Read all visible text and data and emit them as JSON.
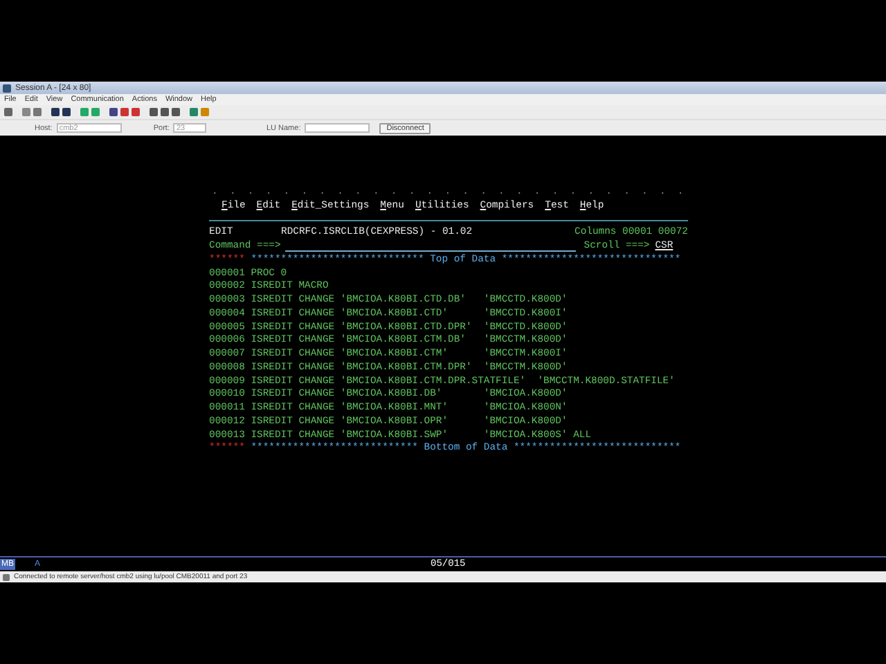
{
  "window": {
    "title": "Session A - [24 x 80]"
  },
  "menu": [
    "File",
    "Edit",
    "View",
    "Communication",
    "Actions",
    "Window",
    "Help"
  ],
  "connection": {
    "host_label": "Host:",
    "host": "cmb2",
    "port_label": "Port:",
    "port": "23",
    "lu_label": "LU Name:",
    "button": "Disconnect"
  },
  "terminal": {
    "action_bar_dots": ".  .  .  .  .  .  .  .  .  .  .  .  .  .  .  .  .  .  .  .  .  .  .  .  .  .  .",
    "action_bar": [
      "File",
      "Edit",
      "Edit_Settings",
      "Menu",
      "Utilities",
      "Compilers",
      "Test",
      "Help"
    ],
    "mode": "EDIT",
    "dataset": "RDCRFC.ISRCLIB(CEXPRESS) - 01.02",
    "columns": "Columns 00001 00072",
    "command_label": "Command ===>",
    "scroll_label": "Scroll ===>",
    "scroll": "CSR",
    "top_marker": "******",
    "top_banner": "***************************** Top of Data ******************************",
    "lines": [
      {
        "number": "000001",
        "text": "PROC 0"
      },
      {
        "number": "000002",
        "text": "ISREDIT MACRO"
      },
      {
        "number": "000003",
        "text": "ISREDIT CHANGE 'BMCIOA.K80BI.CTD.DB'   'BMCCTD.K800D'"
      },
      {
        "number": "000004",
        "text": "ISREDIT CHANGE 'BMCIOA.K80BI.CTD'      'BMCCTD.K800I'"
      },
      {
        "number": "000005",
        "text": "ISREDIT CHANGE 'BMCIOA.K80BI.CTD.DPR'  'BMCCTD.K800D'"
      },
      {
        "number": "000006",
        "text": "ISREDIT CHANGE 'BMCIOA.K80BI.CTM.DB'   'BMCCTM.K800D'"
      },
      {
        "number": "000007",
        "text": "ISREDIT CHANGE 'BMCIOA.K80BI.CTM'      'BMCCTM.K800I'"
      },
      {
        "number": "000008",
        "text": "ISREDIT CHANGE 'BMCIOA.K80BI.CTM.DPR'  'BMCCTM.K800D'"
      },
      {
        "number": "000009",
        "text": "ISREDIT CHANGE 'BMCIOA.K80BI.CTM.DPR.STATFILE'  'BMCCTM.K800D.STATFILE'"
      },
      {
        "number": "000010",
        "text": "ISREDIT CHANGE 'BMCIOA.K80BI.DB'       'BMCIOA.K800D'"
      },
      {
        "number": "000011",
        "text": "ISREDIT CHANGE 'BMCIOA.K80BI.MNT'      'BMCIOA.K800N'"
      },
      {
        "number": "000012",
        "text": "ISREDIT CHANGE 'BMCIOA.K80BI.OPR'      'BMCIOA.K800D'"
      },
      {
        "number": "000013",
        "text": "ISREDIT CHANGE 'BMCIOA.K80BI.SWP'      'BMCIOA.K800S' ALL"
      }
    ],
    "bottom_marker": "******",
    "bottom_banner": "**************************** Bottom of Data ****************************"
  },
  "oia": {
    "indicator": "MB",
    "session": "A",
    "cursor": "05/015"
  },
  "status_bar": {
    "text": "Connected to remote server/host cmb2 using lu/pool CMB20011 and port 23"
  }
}
